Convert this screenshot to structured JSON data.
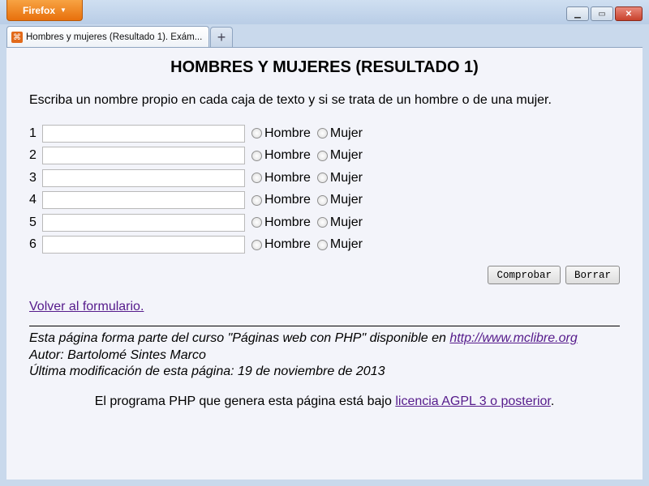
{
  "browser": {
    "menu_button": "Firefox",
    "tab_title": "Hombres y mujeres (Resultado 1). Exám..."
  },
  "page": {
    "title": "HOMBRES Y MUJERES (RESULTADO 1)",
    "intro": "Escriba un nombre propio en cada caja de texto y si se trata de un hombre o de una mujer.",
    "rows": [
      {
        "number": "1",
        "value": ""
      },
      {
        "number": "2",
        "value": ""
      },
      {
        "number": "3",
        "value": ""
      },
      {
        "number": "4",
        "value": ""
      },
      {
        "number": "5",
        "value": ""
      },
      {
        "number": "6",
        "value": ""
      }
    ],
    "option_male": "Hombre",
    "option_female": "Mujer",
    "check_button": "Comprobar",
    "clear_button": "Borrar",
    "back_link": "Volver al formulario.",
    "footer": {
      "line1_prefix": "Esta página forma parte del curso \"Páginas web con PHP\" disponible en ",
      "line1_link": "http://www.mclibre.org",
      "line2": "Autor: Bartolomé Sintes Marco",
      "line3": "Última modificación de esta página: 19 de noviembre de 2013"
    },
    "license": {
      "prefix": "El programa PHP que genera esta página está bajo ",
      "link": "licencia AGPL 3 o posterior",
      "suffix": "."
    }
  }
}
